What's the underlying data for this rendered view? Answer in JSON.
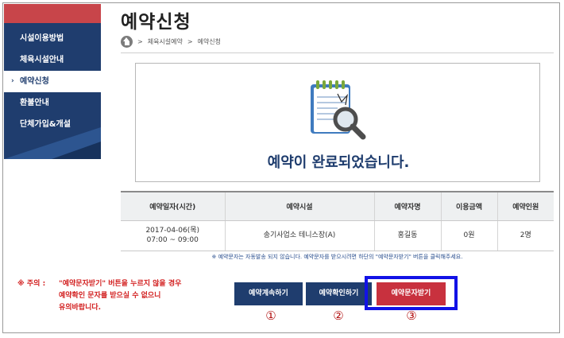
{
  "sidebar": {
    "items": [
      {
        "label": "시설이용방법",
        "active": false
      },
      {
        "label": "체육시설안내",
        "active": false
      },
      {
        "label": "예약신청",
        "active": true
      },
      {
        "label": "환불안내",
        "active": false
      },
      {
        "label": "단체가입&개설",
        "active": false
      }
    ],
    "active_arrow": "›",
    "accent_color": "#c8454a",
    "bg_color": "#1f3d6e"
  },
  "header": {
    "title": "예약신청",
    "breadcrumb": {
      "home_icon": "home-icon",
      "sep1": ">",
      "item1": "체육시설예약",
      "sep2": ">",
      "item2": "예약신청"
    }
  },
  "completion": {
    "icon": "notepad-magnifier-icon",
    "message": "예약이 완료되었습니다."
  },
  "reservation_table": {
    "headers": {
      "date": "예약일자(시간)",
      "facility": "예약시설",
      "name": "예약자명",
      "fee": "이용금액",
      "people": "예약인원"
    },
    "row": {
      "date": "2017-04-06(목)",
      "time": "07:00 ~ 09:00",
      "facility": "송기사업소 테니스장(A)",
      "name": "홍길동",
      "fee": "0원",
      "people": "2명"
    }
  },
  "notice": "※ 예약문자는 자동발송 되지 않습니다. 예약문자를 받으시려면 하단의 \"예약문자받기\" 버튼을 클릭해주세요.",
  "warning": {
    "label": "※ 주의 :",
    "line1": "\"예약문자받기\" 버튼을 누르지 않을 경우",
    "line2": "예약확인 문자를 받으실 수 없으니",
    "line3": "유의바랍니다."
  },
  "buttons": {
    "continue": "예약계속하기",
    "confirm": "예약확인하기",
    "sms": "예약문자받기"
  },
  "markers": {
    "one": "①",
    "two": "②",
    "three": "③"
  },
  "colors": {
    "primary": "#1f3d6e",
    "sms_button": "#c8313e",
    "highlight": "#1212e6",
    "warning_text": "#d21e1e"
  }
}
